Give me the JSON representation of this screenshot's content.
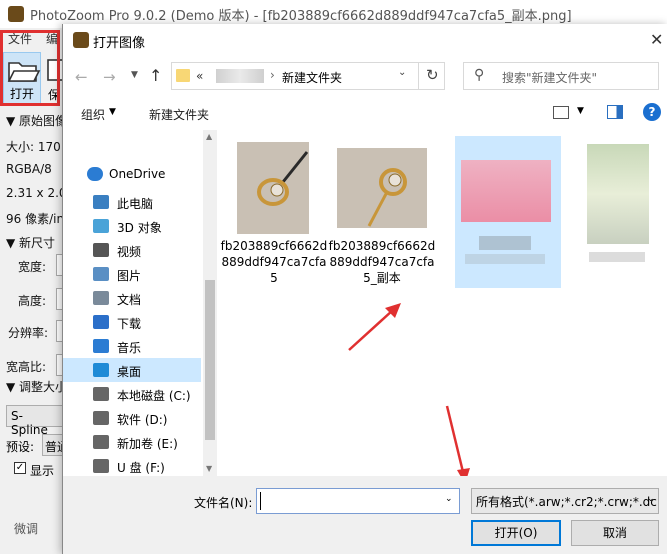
{
  "app": {
    "title": "PhotoZoom Pro 9.0.2 (Demo 版本) - [fb203889cf6662d889ddf947ca7cfa5_副本.png]",
    "menu": [
      "文件",
      "编"
    ],
    "toolbar": {
      "open_label": "打开",
      "save_label": "保"
    },
    "left_panel": {
      "original_image": "▼ 原始图像",
      "size": "大小: 170.",
      "color": "RGBA/8",
      "dimensions": "2.31 x 2.0",
      "resolution": "96 像素/in",
      "new_size": "▼ 新尺寸",
      "width": "宽度:",
      "height": "高度:",
      "resolution_label": "分辨率:",
      "aspect": "宽高比:",
      "resize": "▼ 调整大小",
      "method": "S-Spline",
      "preset": "预设:",
      "preset_value": "普通",
      "show": "显示",
      "fine_tune": "微调"
    }
  },
  "dialog": {
    "title": "打开图像",
    "address": {
      "prefix": "«",
      "separator": "›",
      "current": "新建文件夹"
    },
    "search_placeholder": "搜索\"新建文件夹\"",
    "organize_label": "组织",
    "new_folder_label": "新建文件夹",
    "nav_items": [
      {
        "label": "OneDrive",
        "icon": "cloud-icon",
        "color": "#2b7cd3"
      },
      {
        "label": "此电脑",
        "icon": "computer-icon",
        "color": "#3a7fc1"
      },
      {
        "label": "3D 对象",
        "icon": "cube-icon",
        "color": "#4aa3d8"
      },
      {
        "label": "视频",
        "icon": "film-icon",
        "color": "#555555"
      },
      {
        "label": "图片",
        "icon": "picture-icon",
        "color": "#5a8fc4"
      },
      {
        "label": "文档",
        "icon": "document-icon",
        "color": "#7a8a9a"
      },
      {
        "label": "下载",
        "icon": "download-icon",
        "color": "#2b6fc9"
      },
      {
        "label": "音乐",
        "icon": "music-icon",
        "color": "#2b7cd3"
      },
      {
        "label": "桌面",
        "icon": "desktop-icon",
        "color": "#1e8ad6"
      },
      {
        "label": "本地磁盘 (C:)",
        "icon": "drive-icon",
        "color": "#666666"
      },
      {
        "label": "软件 (D:)",
        "icon": "drive-icon",
        "color": "#666666"
      },
      {
        "label": "新加卷 (E:)",
        "icon": "drive-icon",
        "color": "#666666"
      },
      {
        "label": "U 盘 (F:)",
        "icon": "usb-drive-icon",
        "color": "#666666"
      }
    ],
    "selected_nav": "桌面",
    "files": [
      {
        "name": "fb203889cf6662d889ddf947ca7cfa5"
      },
      {
        "name": "fb203889cf6662d889ddf947ca7cfa5_副本"
      }
    ],
    "filename_label": "文件名(N):",
    "filename_value": "",
    "filter_value": "所有格式(*.arw;*.cr2;*.crw;*.dc",
    "open_button": "打开(O)",
    "cancel_button": "取消"
  },
  "annotations": {
    "highlight_color": "#e03030",
    "arrow_color": "#e03030"
  }
}
